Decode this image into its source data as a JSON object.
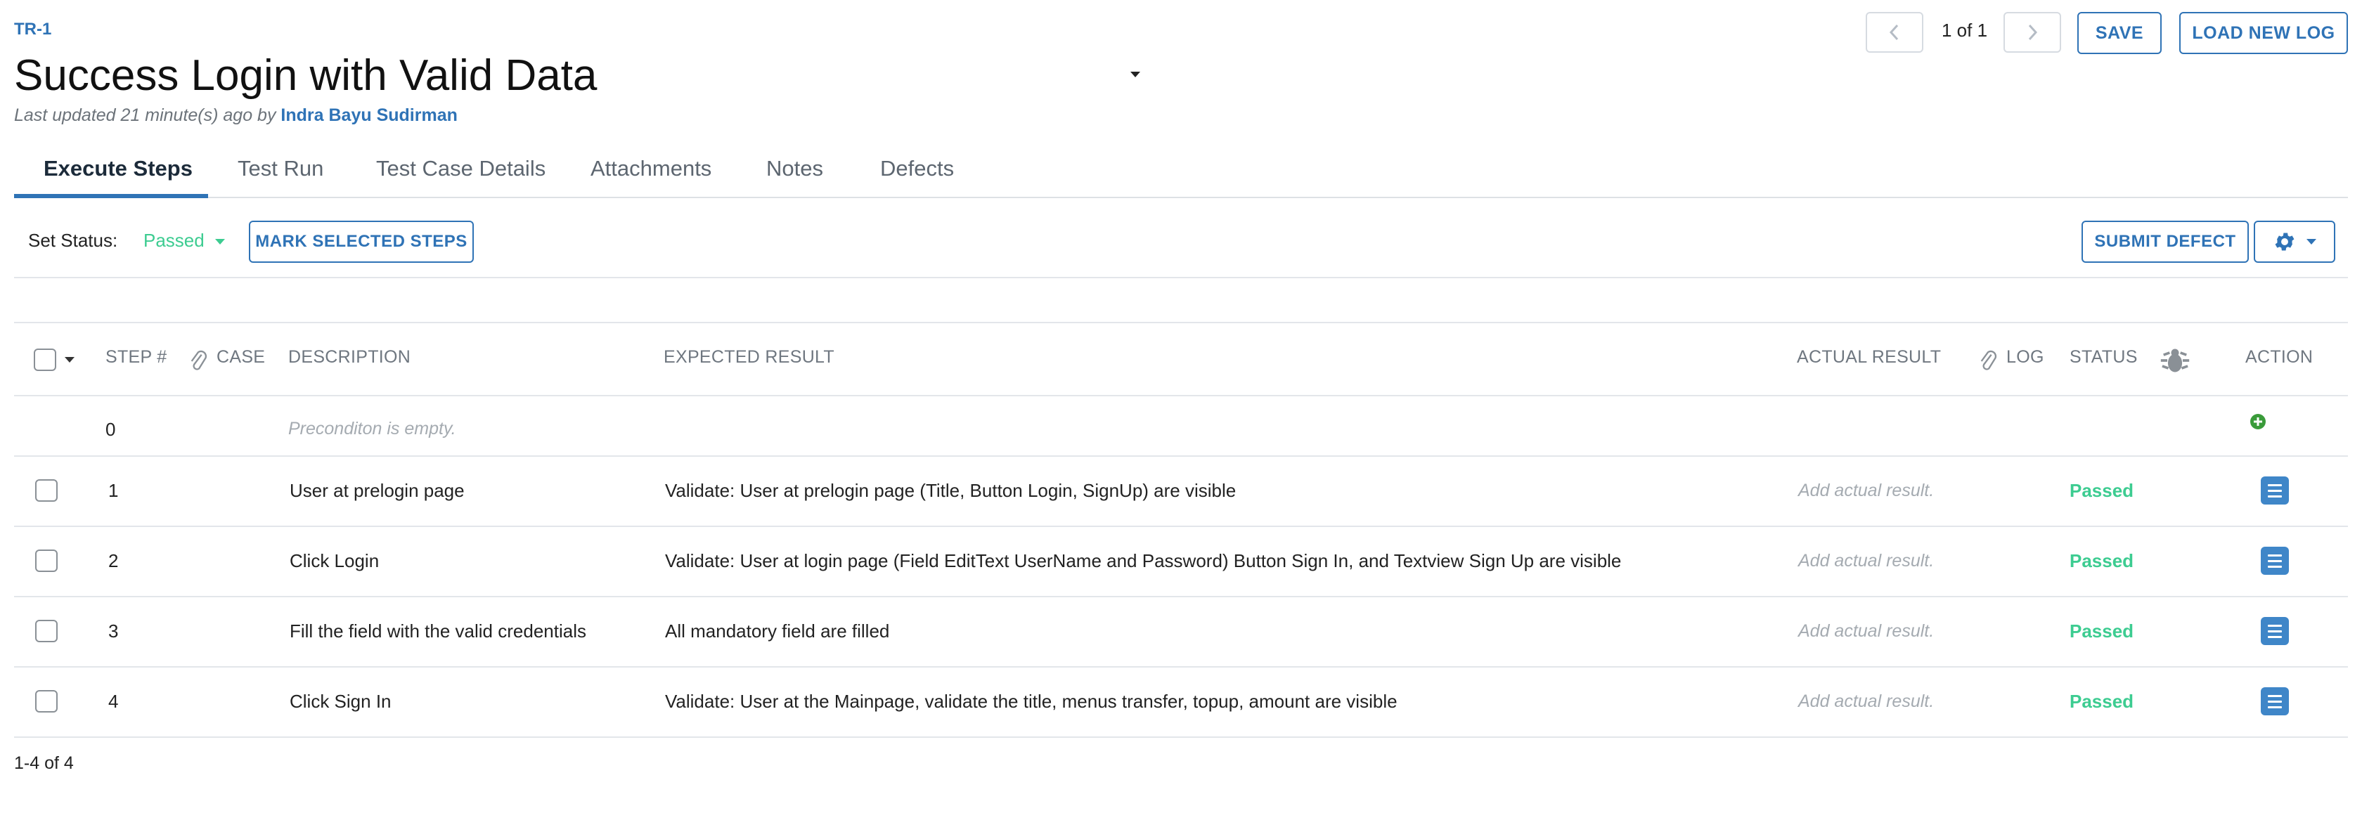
{
  "header": {
    "case_id": "TR-1",
    "title": "Success Login with Valid Data",
    "updated_prefix": "Last updated 21 minute(s) ago by",
    "updated_by": "Indra Bayu Sudirman",
    "pager": "1 of 1",
    "save_label": "SAVE",
    "load_log_label": "LOAD NEW LOG"
  },
  "tabs": [
    {
      "label": "Execute Steps",
      "active": true
    },
    {
      "label": "Test Run",
      "active": false
    },
    {
      "label": "Test Case Details",
      "active": false
    },
    {
      "label": "Attachments",
      "active": false
    },
    {
      "label": "Notes",
      "active": false
    },
    {
      "label": "Defects",
      "active": false
    }
  ],
  "toolbar": {
    "set_status_label": "Set Status:",
    "status_value": "Passed",
    "mark_selected_label": "MARK SELECTED STEPS",
    "submit_defect_label": "SUBMIT DEFECT"
  },
  "table": {
    "columns": {
      "step": "STEP #",
      "case": "CASE",
      "description": "DESCRIPTION",
      "expected": "EXPECTED RESULT",
      "actual": "ACTUAL RESULT",
      "log": "LOG",
      "status": "STATUS",
      "action": "ACTION"
    },
    "precondition": {
      "step": "0",
      "text": "Preconditon is empty."
    },
    "rows": [
      {
        "step": "1",
        "description": "User at prelogin page",
        "expected": "Validate: User at prelogin page (Title, Button Login, SignUp) are visible",
        "actual_placeholder": "Add actual result.",
        "status": "Passed"
      },
      {
        "step": "2",
        "description": "Click Login",
        "expected": "Validate: User at login page (Field EditText UserName and Password) Button Sign In, and Textview Sign Up are visible",
        "actual_placeholder": "Add actual result.",
        "status": "Passed"
      },
      {
        "step": "3",
        "description": "Fill the field with the valid credentials",
        "expected": "All mandatory field are filled",
        "actual_placeholder": "Add actual result.",
        "status": "Passed"
      },
      {
        "step": "4",
        "description": "Click Sign In",
        "expected": "Validate: User at the Mainpage, validate the title, menus transfer, topup, amount are visible",
        "actual_placeholder": "Add actual result.",
        "status": "Passed"
      }
    ],
    "footer_count": "1-4 of 4"
  },
  "colors": {
    "accent": "#2f73b6",
    "passed": "#3dcc91",
    "add_icon": "#3a9b3a"
  },
  "icons": [
    "chevron-left-icon",
    "chevron-right-icon",
    "gear-icon",
    "paperclip-icon",
    "bug-icon",
    "add-circle-icon",
    "menu-lines-icon",
    "caret-down-icon"
  ]
}
